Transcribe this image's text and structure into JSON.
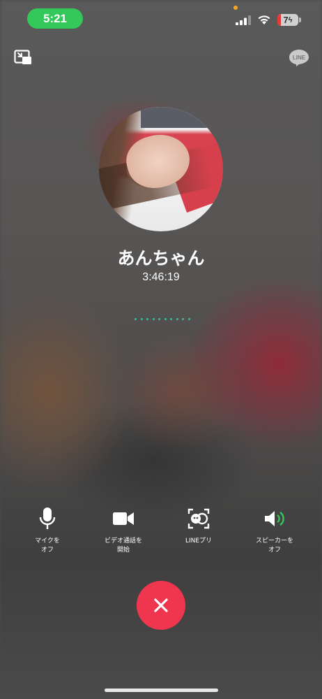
{
  "status_bar": {
    "time": "5:21",
    "battery": "7"
  },
  "call": {
    "contact_name": "あんちゃん",
    "duration": "3:46:19"
  },
  "controls": [
    {
      "label": "マイクを\nオフ",
      "icon": "microphone-icon"
    },
    {
      "label": "ビデオ通話を\n開始",
      "icon": "video-camera-icon"
    },
    {
      "label": "LINEプリ",
      "icon": "face-filter-icon"
    },
    {
      "label": "スピーカーを\nオフ",
      "icon": "speaker-icon"
    }
  ],
  "top_bar": {
    "left_icon": "minimize-icon",
    "right_icon": "line-logo-icon",
    "logo_text": "LINE"
  },
  "colors": {
    "status_time_bg": "#34c759",
    "end_call": "#f0364e",
    "connection_dots": "#3bc09a",
    "speaker_active": "#34c759"
  }
}
